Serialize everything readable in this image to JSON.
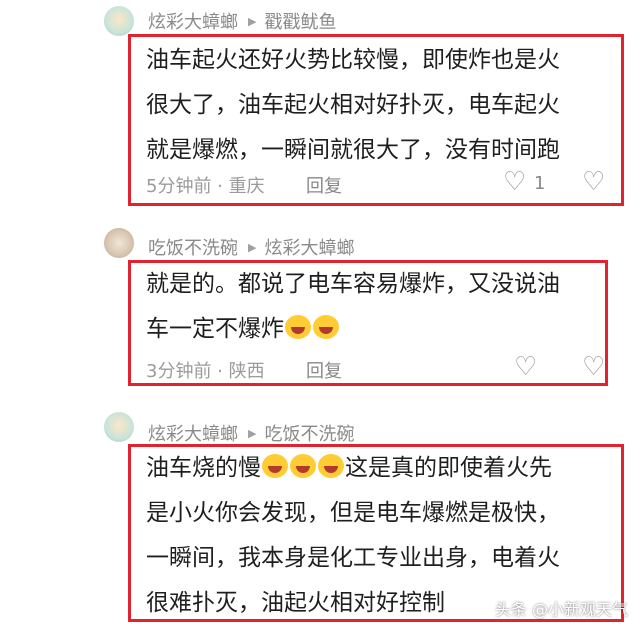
{
  "comments": [
    {
      "author": "炫彩大蟑螂",
      "reply_to": "戳戳鱿鱼",
      "lines": [
        "油车起火还好火势比较慢，即使炸也是火",
        "很大了，油车起火相对好扑灭，电车起火",
        "就是爆燃，一瞬间就很大了，没有时间跑"
      ],
      "time_loc": "5分钟前 · 重庆",
      "reply_label": "回复",
      "likes": "1"
    },
    {
      "author": "吃饭不洗碗",
      "reply_to": "炫彩大蟑螂",
      "lines": [
        "就是的。都说了电车容易爆炸，又没说油",
        "车一定不爆炸"
      ],
      "time_loc": "3分钟前 · 陕西",
      "reply_label": "回复"
    },
    {
      "author": "炫彩大蟑螂",
      "reply_to": "吃饭不洗碗",
      "lines": [
        "油车烧的慢",
        "这是真的即使着火先",
        "是小火你会发现，但是电车爆燃是极快，",
        "一瞬间，我本身是化工专业出身，电着火",
        "很难扑灭，油起火相对好控制"
      ]
    }
  ],
  "watermark": "头条 @小新观天气",
  "colors": {
    "highlight_border": "#e0242f",
    "meta_gray": "#9b9b9b"
  },
  "icons": [
    "heart-outline-icon",
    "broken-heart-icon"
  ]
}
